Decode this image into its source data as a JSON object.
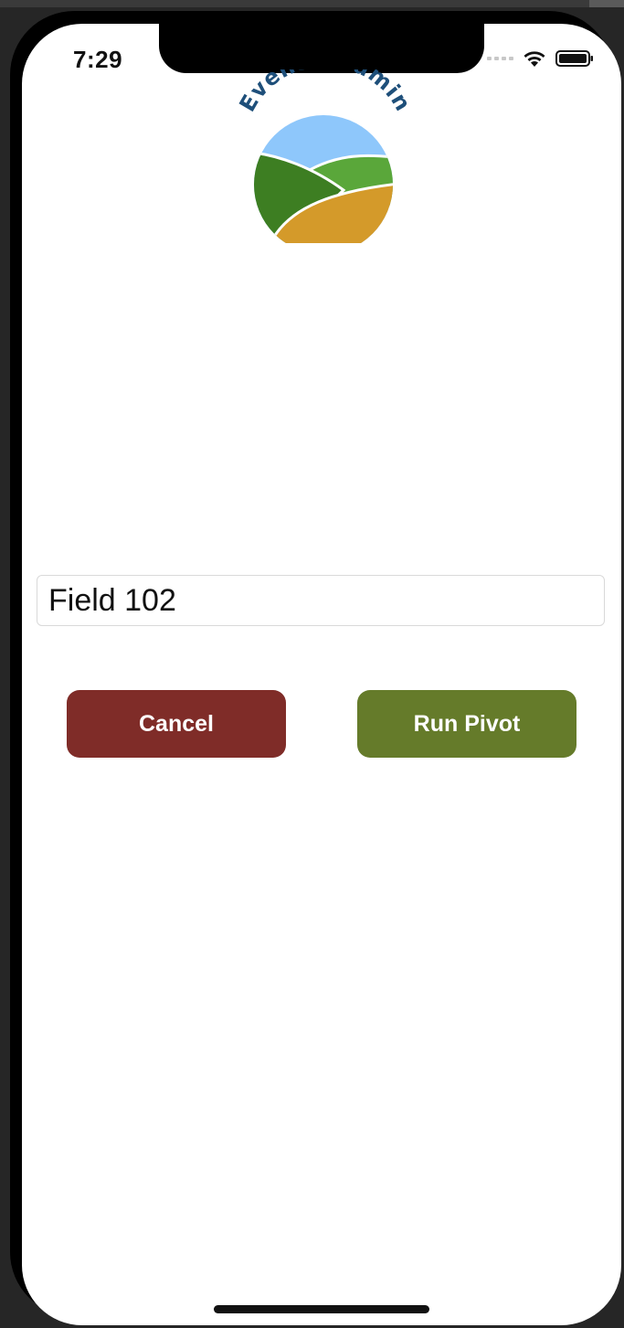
{
  "status_bar": {
    "time": "7:29",
    "icons": [
      "cellular-signal-icon",
      "wifi-icon",
      "battery-icon"
    ]
  },
  "logo": {
    "text": "EvenStreamin",
    "colors": {
      "text": "#1e4f7a",
      "sky": "#8ec7fb",
      "light_field": "#5aa73a",
      "dark_field": "#3d7e22",
      "golden_field": "#d49a2a"
    }
  },
  "field_input": {
    "value": "Field 102",
    "placeholder": ""
  },
  "buttons": {
    "cancel_label": "Cancel",
    "run_label": "Run Pivot"
  },
  "colors": {
    "cancel_button": "#7f2c28",
    "run_button": "#657b2a",
    "background": "#ffffff"
  }
}
